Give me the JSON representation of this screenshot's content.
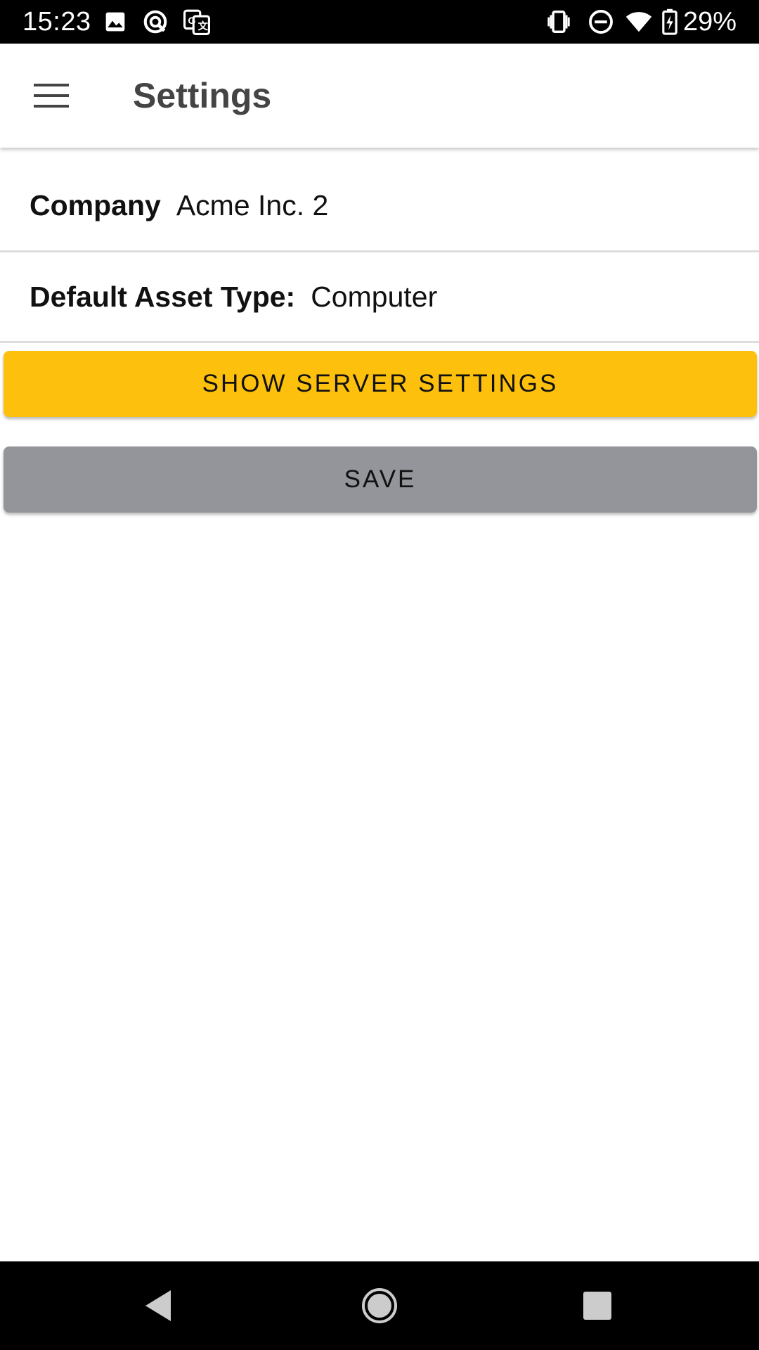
{
  "status_bar": {
    "time": "15:23",
    "battery_percent": "29%",
    "left_icons": [
      "image-icon",
      "sync-icon",
      "translate-icon"
    ],
    "right_icons": [
      "vibrate-icon",
      "do-not-disturb-icon",
      "wifi-icon",
      "battery-charging-icon"
    ]
  },
  "app_bar": {
    "menu_icon": "hamburger-menu-icon",
    "title": "Settings"
  },
  "settings": {
    "company_label": "Company",
    "company_value": "Acme Inc. 2",
    "asset_type_label": "Default Asset Type:",
    "asset_type_value": "Computer"
  },
  "buttons": {
    "show_server_settings": "SHOW SERVER SETTINGS",
    "save": "SAVE"
  },
  "colors": {
    "accent_yellow": "#fcc00d",
    "save_gray": "#93959b"
  },
  "nav_bar": {
    "icons": [
      "back-icon",
      "home-icon",
      "recents-icon"
    ]
  }
}
